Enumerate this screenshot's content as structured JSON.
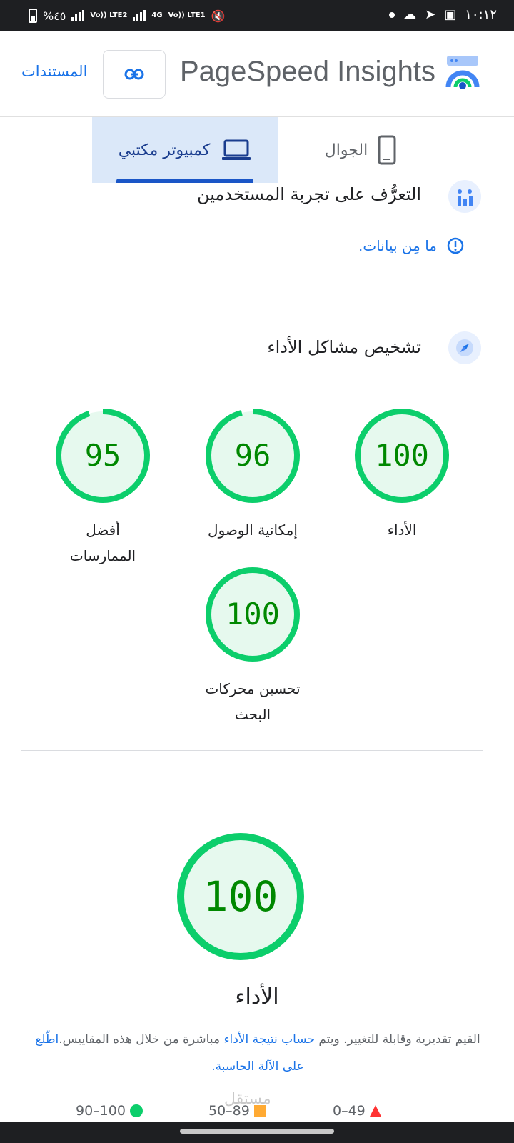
{
  "status_bar": {
    "time": "١٠:١٢",
    "battery_text": "%٤٥",
    "sim1_label": "Vo)) LTE2",
    "net_label": "4G",
    "sim2_label": "Vo)) LTE1"
  },
  "header": {
    "title": "PageSpeed Insights",
    "docs_label": "المستندات"
  },
  "tabs": {
    "desktop_label": "كمبيوتر مكتبي",
    "mobile_label": "الجوال"
  },
  "ux_section": {
    "title": "التعرُّف على تجربة المستخدمين",
    "no_data": "ما مِن بيانات."
  },
  "diagnose_section": {
    "title": "تشخيص مشاكل الأداء"
  },
  "scores": [
    {
      "label": "الأداء",
      "value": "100",
      "fraction": 1.0
    },
    {
      "label": "إمكانية الوصول",
      "value": "96",
      "fraction": 0.96
    },
    {
      "label": "أفضل الممارسات",
      "value": "95",
      "fraction": 0.95
    },
    {
      "label": "تحسين محركات البحث",
      "value": "100",
      "fraction": 1.0
    }
  ],
  "performance": {
    "value": "100",
    "label": "الأداء",
    "desc_part1": "القيم تقديرية وقابلة للتغيير. ويتم ",
    "desc_link1": "حساب نتيجة الأداء",
    "desc_part2": " مباشرة من خلال هذه المقاييس.",
    "desc_link2": "اطّلع على الآلة الحاسبة."
  },
  "legend": {
    "fail": "0–49",
    "average": "50–89",
    "pass": "90–100"
  },
  "watermark": "مستقل",
  "colors": {
    "pass": "#0cce6b",
    "pass_bg": "#e6f9ee",
    "pass_text": "#008800",
    "average": "#ffaa33",
    "fail": "#ff3333",
    "accent": "#1a73e8"
  },
  "icons": {
    "logo": "pagespeed-logo-icon",
    "link": "link-icon",
    "desktop": "laptop-icon",
    "mobile": "phone-icon",
    "ux": "chart-people-icon",
    "diagnose": "compass-icon",
    "info": "info-circle-icon"
  }
}
